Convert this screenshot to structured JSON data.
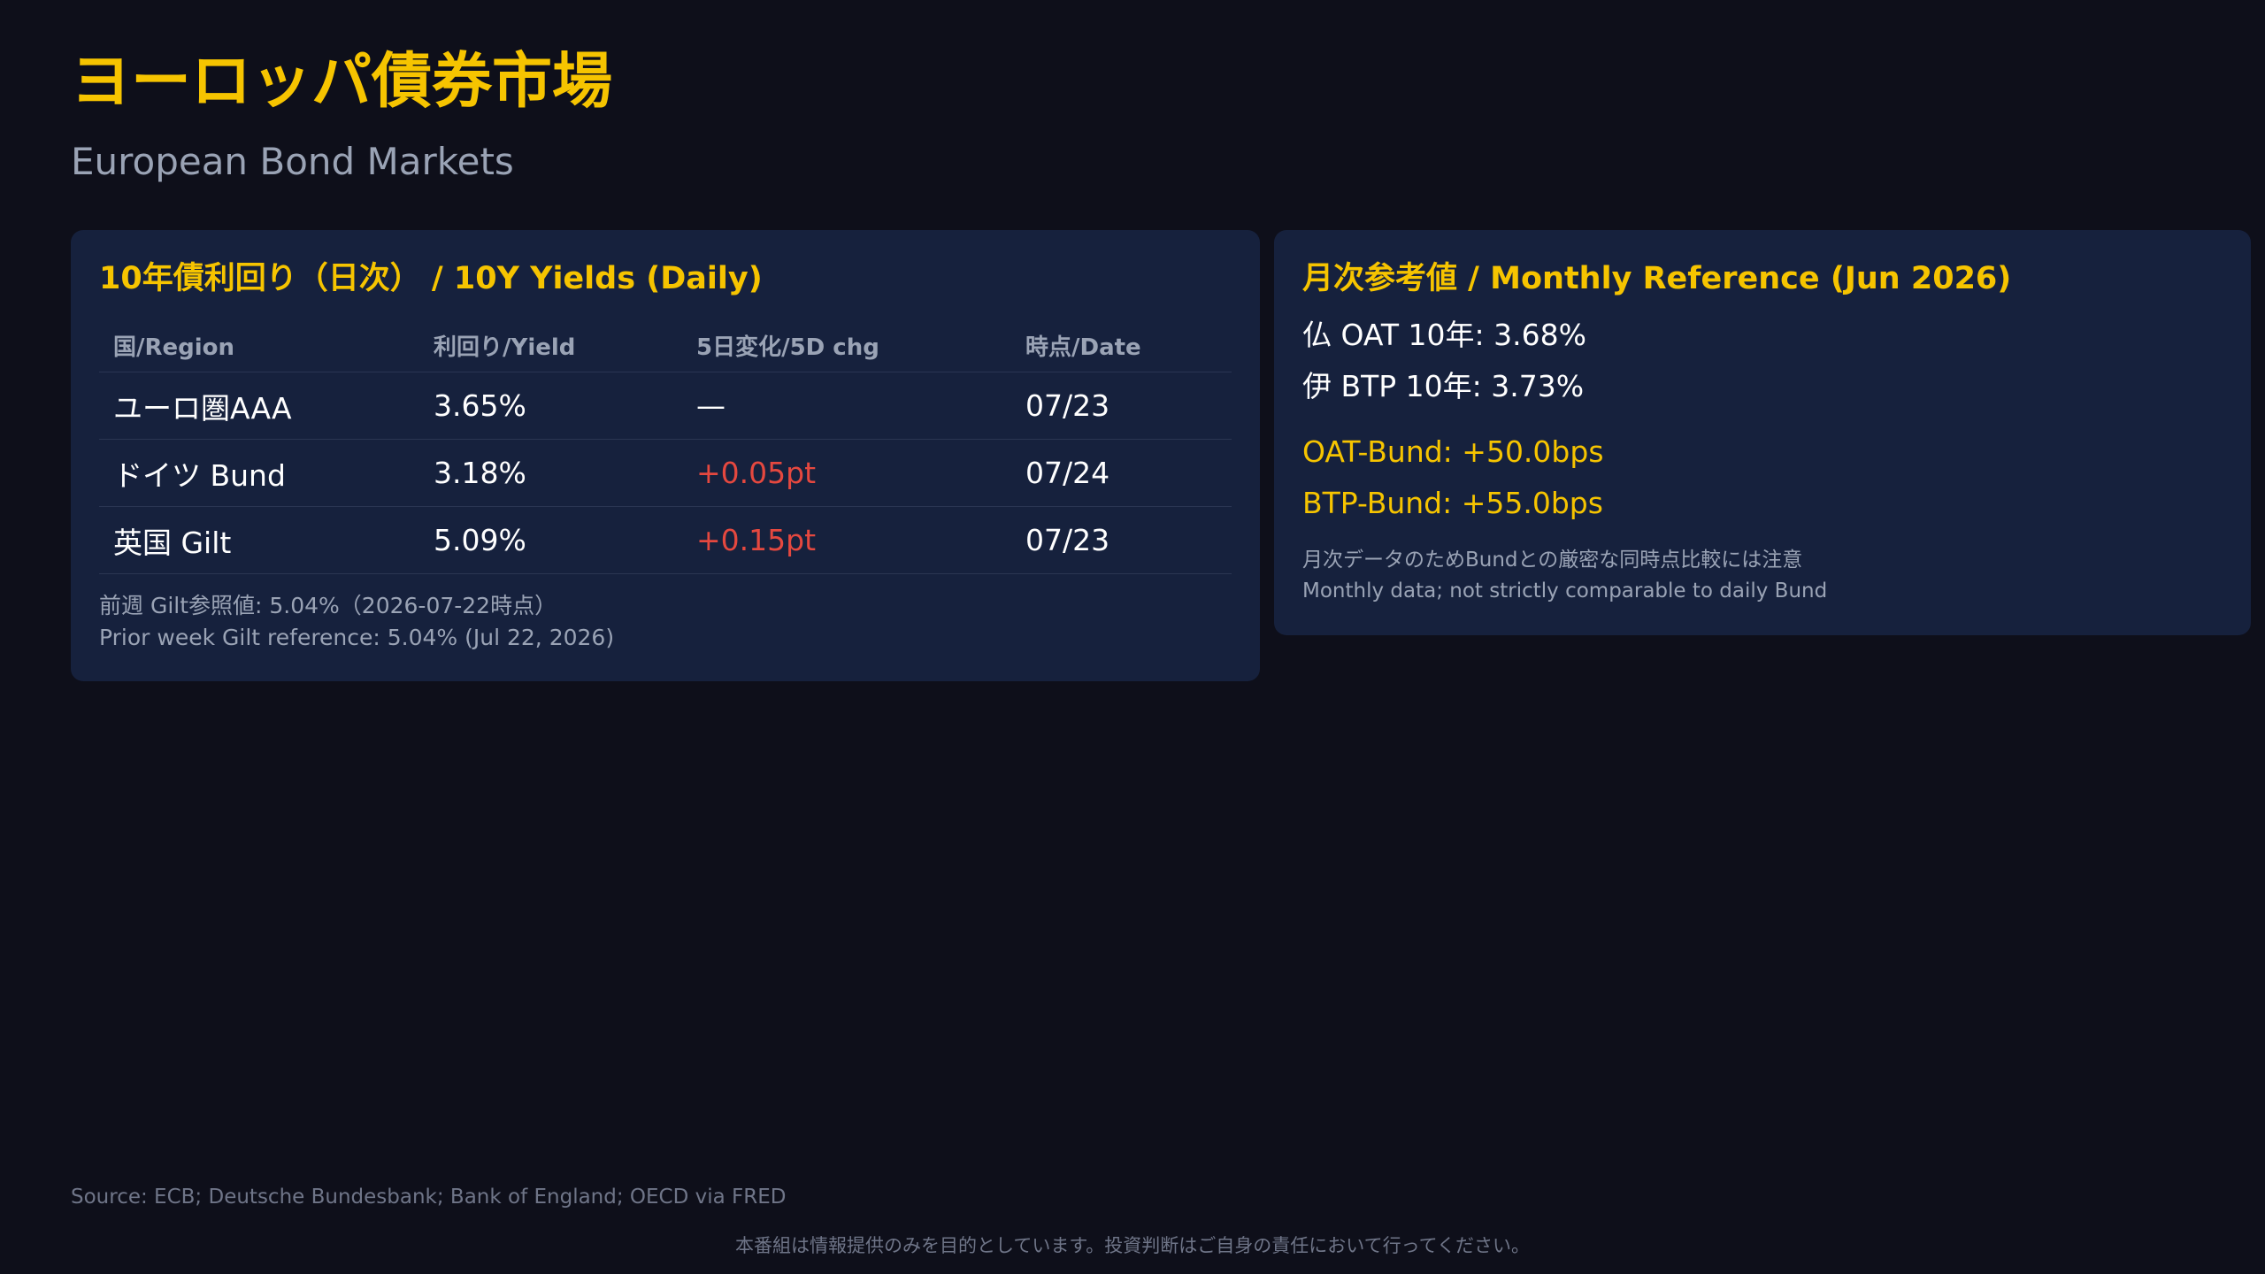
{
  "header": {
    "title": "ヨーロッパ債券市場",
    "subtitle": "European Bond Markets"
  },
  "daily_card": {
    "title": "10年債利回り（日次） / 10Y Yields (Daily)",
    "columns": [
      "国/Region",
      "利回り/Yield",
      "5日変化/5D chg",
      "時点/Date"
    ],
    "rows": [
      {
        "region": "ユーロ圏AAA",
        "yield": "3.65%",
        "change": "—",
        "date": "07/23"
      },
      {
        "region": "ドイツ Bund",
        "yield": "3.18%",
        "change": "+0.05pt",
        "date": "07/24"
      },
      {
        "region": "英国 Gilt",
        "yield": "5.09%",
        "change": "+0.15pt",
        "date": "07/23"
      }
    ],
    "note_jp": "前週 Gilt参照値: 5.04%（2026-07-22時点）",
    "note_en": "Prior week Gilt reference: 5.04% (Jul 22, 2026)"
  },
  "monthly_card": {
    "title": "月次参考値 / Monthly Reference (Jun 2026)",
    "oat": "仏 OAT 10年: 3.68%",
    "btp": "伊 BTP 10年: 3.73%",
    "oat_spread": "OAT-Bund: +50.0bps",
    "btp_spread": "BTP-Bund: +55.0bps",
    "note_jp": "月次データのためBundとの厳密な同時点比較には注意",
    "note_en": "Monthly data; not strictly comparable to daily Bund"
  },
  "footer": {
    "source": "Source: ECB; Deutsche Bundesbank; Bank of England; OECD via FRED",
    "disclaimer": "本番組は情報提供のみを目的としています。投資判断はご自身の責任において行ってください。"
  },
  "colors": {
    "background": "#0e0f1a",
    "card": "#16213d",
    "accent": "#f6c400",
    "positive_change": "#e5483f",
    "muted_text": "#9aa3b5"
  }
}
